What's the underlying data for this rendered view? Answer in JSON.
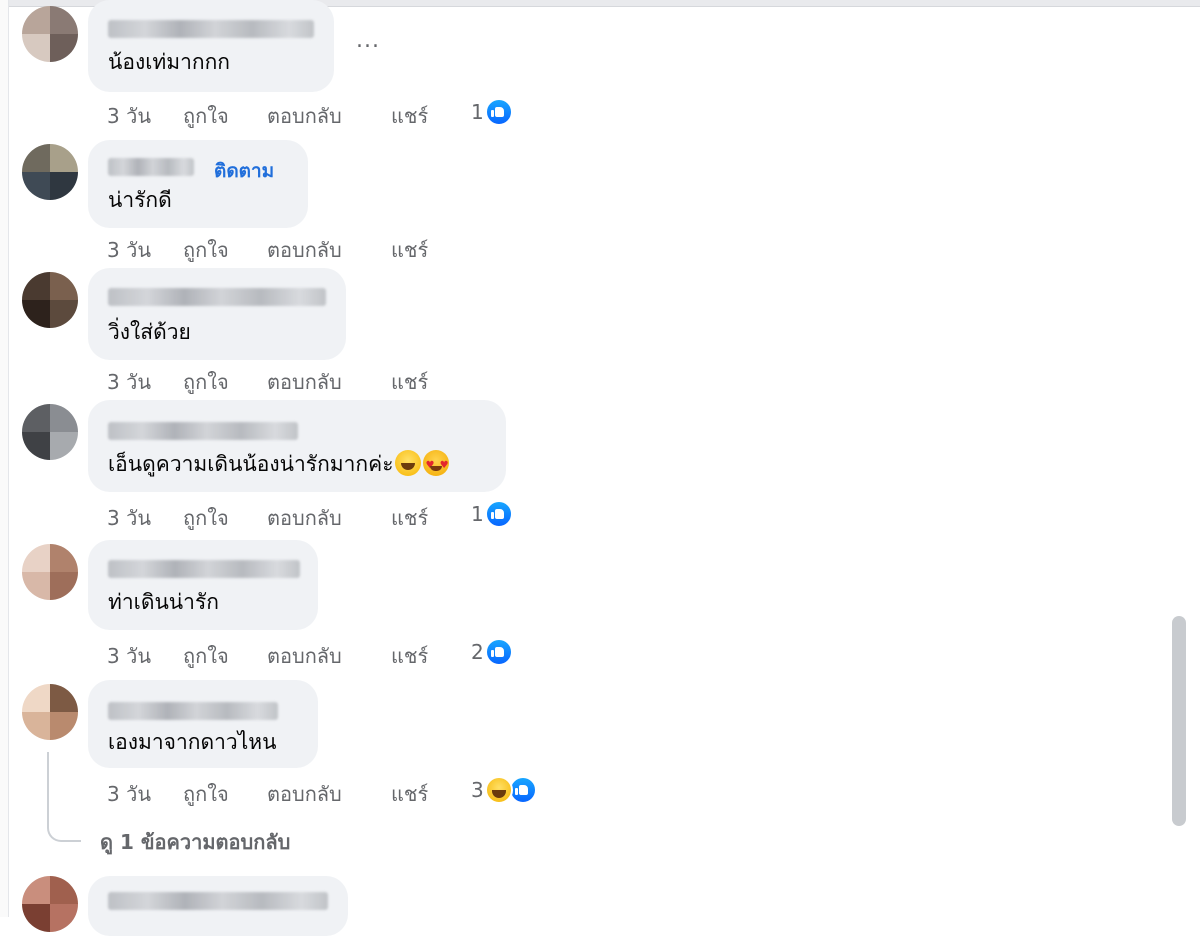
{
  "comments": [
    {
      "text": "น้องเท่มากกก",
      "time": "3 วัน",
      "like": "ถูกใจ",
      "reply": "ตอบกลับ",
      "share": "แชร์",
      "reaction_count": "1",
      "reactions": [
        "like-icon"
      ],
      "avatar_colors": [
        "#b8a59a",
        "#8a7a74",
        "#d7c9c0",
        "#6e5f5a"
      ]
    },
    {
      "text": "น่ารักดี",
      "follow": "ติดตาม",
      "time": "3 วัน",
      "like": "ถูกใจ",
      "reply": "ตอบกลับ",
      "share": "แชร์",
      "avatar_colors": [
        "#6f6a5e",
        "#3f4a55",
        "#a8a08a",
        "#2f3740"
      ]
    },
    {
      "text": "วิ่งใส่ด้วย",
      "time": "3 วัน",
      "like": "ถูกใจ",
      "reply": "ตอบกลับ",
      "share": "แชร์",
      "avatar_colors": [
        "#4a3a30",
        "#7a604e",
        "#2d221c",
        "#5c4a3d"
      ]
    },
    {
      "text": "เอ็นดูความเดินน้องน่ารักมากค่ะ",
      "emojis": [
        "laughing-crying-emoji",
        "heart-eyes-emoji"
      ],
      "time": "3 วัน",
      "like": "ถูกใจ",
      "reply": "ตอบกลับ",
      "share": "แชร์",
      "reaction_count": "1",
      "reactions": [
        "like-icon"
      ],
      "avatar_colors": [
        "#5d5f63",
        "#8a8d92",
        "#3f4145",
        "#a7aaae"
      ]
    },
    {
      "text": "ท่าเดินน่ารัก",
      "time": "3 วัน",
      "like": "ถูกใจ",
      "reply": "ตอบกลับ",
      "share": "แชร์",
      "reaction_count": "2",
      "reactions": [
        "like-icon"
      ],
      "avatar_colors": [
        "#d8b8a8",
        "#b0826c",
        "#e8d2c6",
        "#9e6e5a"
      ]
    },
    {
      "text": "เองมาจากดาวไหน",
      "time": "3 วัน",
      "like": "ถูกใจ",
      "reply": "ตอบกลับ",
      "share": "แชร์",
      "reaction_count": "3",
      "reactions": [
        "haha-icon",
        "like-icon"
      ],
      "avatar_colors": [
        "#d9b49a",
        "#b98a6e",
        "#efd8c6",
        "#7d5a44"
      ]
    }
  ],
  "view_replies": "ดู 1 ข้อความตอบกลับ",
  "more_options": "...",
  "colors": {
    "link_blue": "#216fdb",
    "meta_gray": "#65676b",
    "bubble": "#f0f2f5",
    "like_blue": "#0866ff"
  }
}
